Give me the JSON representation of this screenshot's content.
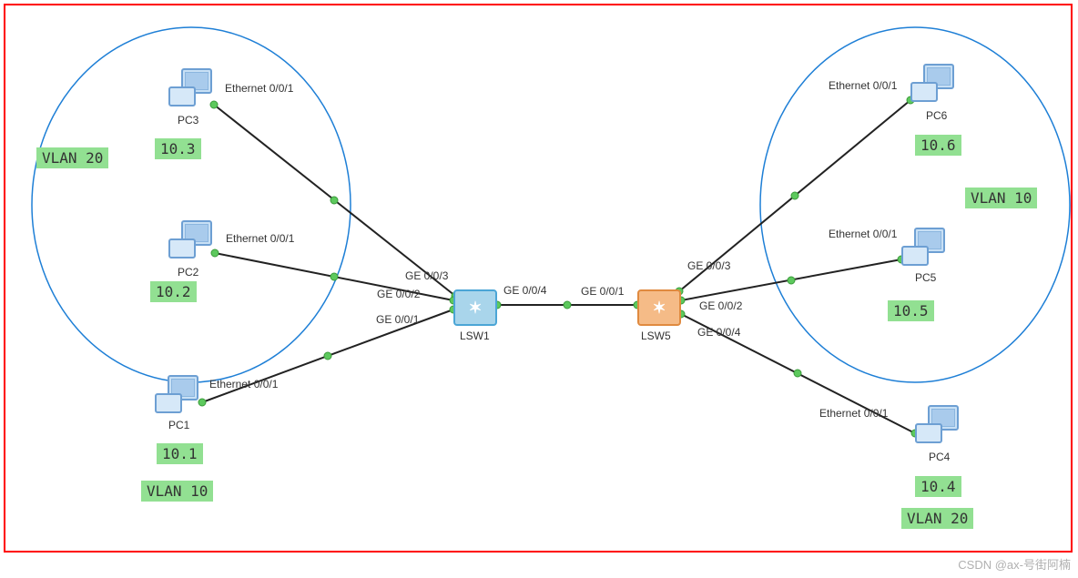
{
  "nodes": {
    "pc1": {
      "name": "PC1",
      "ip": "10.1",
      "eth": "Ethernet 0/0/1"
    },
    "pc2": {
      "name": "PC2",
      "ip": "10.2",
      "eth": "Ethernet 0/0/1"
    },
    "pc3": {
      "name": "PC3",
      "ip": "10.3",
      "eth": "Ethernet 0/0/1"
    },
    "pc4": {
      "name": "PC4",
      "ip": "10.4",
      "eth": "Ethernet 0/0/1"
    },
    "pc5": {
      "name": "PC5",
      "ip": "10.5",
      "eth": "Ethernet 0/0/1"
    },
    "pc6": {
      "name": "PC6",
      "ip": "10.6",
      "eth": "Ethernet 0/0/1"
    },
    "lsw1": {
      "name": "LSW1"
    },
    "lsw5": {
      "name": "LSW5"
    }
  },
  "ports": {
    "lsw1_ge1": "GE 0/0/1",
    "lsw1_ge2": "GE 0/0/2",
    "lsw1_ge3": "GE 0/0/3",
    "lsw1_ge4": "GE 0/0/4",
    "lsw5_ge1": "GE 0/0/1",
    "lsw5_ge2": "GE 0/0/2",
    "lsw5_ge3": "GE 0/0/3",
    "lsw5_ge4": "GE 0/0/4"
  },
  "vlans": {
    "vlan10": "VLAN 10",
    "vlan20": "VLAN 20",
    "vlan10_right": "VLAN 10",
    "vlan20_right": "VLAN 20"
  },
  "watermark": "CSDN @ax-号街阿楠",
  "chart_data": {
    "type": "network-topology",
    "devices": [
      {
        "id": "PC1",
        "type": "pc",
        "ip": "10.1",
        "vlan": 10,
        "interface": "Ethernet 0/0/1"
      },
      {
        "id": "PC2",
        "type": "pc",
        "ip": "10.2",
        "vlan": 20,
        "interface": "Ethernet 0/0/1"
      },
      {
        "id": "PC3",
        "type": "pc",
        "ip": "10.3",
        "vlan": 20,
        "interface": "Ethernet 0/0/1"
      },
      {
        "id": "PC4",
        "type": "pc",
        "ip": "10.4",
        "vlan": 20,
        "interface": "Ethernet 0/0/1"
      },
      {
        "id": "PC5",
        "type": "pc",
        "ip": "10.5",
        "vlan": 10,
        "interface": "Ethernet 0/0/1"
      },
      {
        "id": "PC6",
        "type": "pc",
        "ip": "10.6",
        "vlan": 10,
        "interface": "Ethernet 0/0/1"
      },
      {
        "id": "LSW1",
        "type": "switch"
      },
      {
        "id": "LSW5",
        "type": "switch"
      }
    ],
    "links": [
      {
        "from": "PC1",
        "from_port": "Ethernet 0/0/1",
        "to": "LSW1",
        "to_port": "GE 0/0/1"
      },
      {
        "from": "PC2",
        "from_port": "Ethernet 0/0/1",
        "to": "LSW1",
        "to_port": "GE 0/0/2"
      },
      {
        "from": "PC3",
        "from_port": "Ethernet 0/0/1",
        "to": "LSW1",
        "to_port": "GE 0/0/3"
      },
      {
        "from": "LSW1",
        "from_port": "GE 0/0/4",
        "to": "LSW5",
        "to_port": "GE 0/0/1"
      },
      {
        "from": "LSW5",
        "from_port": "GE 0/0/2",
        "to": "PC5",
        "to_port": "Ethernet 0/0/1"
      },
      {
        "from": "LSW5",
        "from_port": "GE 0/0/3",
        "to": "PC6",
        "to_port": "Ethernet 0/0/1"
      },
      {
        "from": "LSW5",
        "from_port": "GE 0/0/4",
        "to": "PC4",
        "to_port": "Ethernet 0/0/1"
      }
    ],
    "vlan_groups": [
      {
        "vlan": 20,
        "members": [
          "PC2",
          "PC3"
        ],
        "label_pos": "left"
      },
      {
        "vlan": 10,
        "members": [
          "PC5",
          "PC6"
        ],
        "label_pos": "right"
      },
      {
        "vlan": 10,
        "members": [
          "PC1"
        ]
      },
      {
        "vlan": 20,
        "members": [
          "PC4"
        ]
      }
    ]
  }
}
